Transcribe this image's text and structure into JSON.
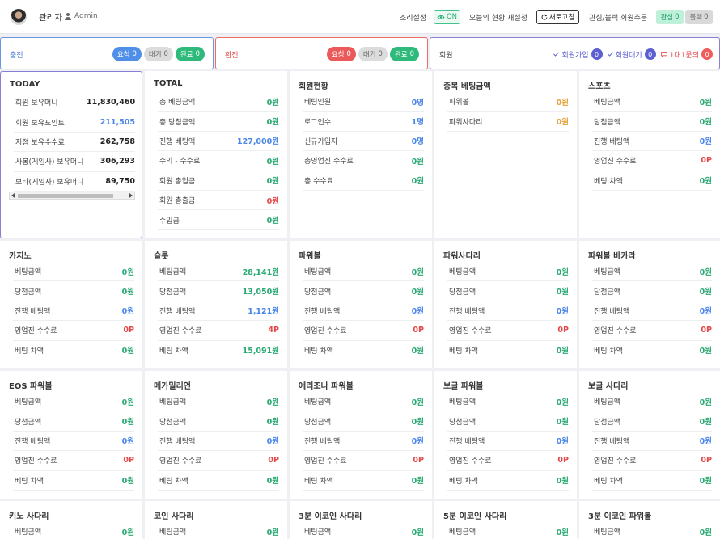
{
  "header": {
    "user_name": "관리자",
    "user_role": "Admin",
    "sound_label": "소리설정",
    "sound_button": "ON",
    "today_reset_label": "오늘의 현황 재설정",
    "refresh_button": "새로고침",
    "interest_label": "관심/블랙 회원주문",
    "interest_button": "관심",
    "interest_count": "0",
    "block_button": "블랙",
    "block_count": "0"
  },
  "status": {
    "deposit": {
      "title": "충전",
      "request": "요청",
      "request_count": "0",
      "wait": "대기",
      "wait_count": "0",
      "done": "완료",
      "done_count": "0"
    },
    "withdraw": {
      "title": "환전",
      "request": "요청",
      "request_count": "0",
      "wait": "대기",
      "wait_count": "0",
      "done": "완료",
      "done_count": "0"
    },
    "member": {
      "title": "회원",
      "join": "회원가입",
      "join_count": "0",
      "wait": "회원대기",
      "wait_count": "0",
      "inquiry": "1대1문의",
      "inquiry_count": "0"
    }
  },
  "cards": {
    "today": {
      "title": "TODAY",
      "rows": [
        {
          "label": "회원 보유머니",
          "value": "11,830,460"
        },
        {
          "label": "회원 보유포인트",
          "value": "211,505"
        },
        {
          "label": "지점 보유수수료",
          "value": "262,758"
        },
        {
          "label": "사봉(게임사) 보유머니",
          "value": "306,293"
        },
        {
          "label": "보타(게임사) 보유머니",
          "value": "89,750"
        }
      ]
    },
    "total": {
      "title": "TOTAL",
      "rows": [
        {
          "label": "총 베팅금액",
          "value": "0원"
        },
        {
          "label": "총 당첨금액",
          "value": "0원"
        },
        {
          "label": "진행 베팅액",
          "value": "127,000원"
        },
        {
          "label": "수익 - 수수료",
          "value": "0원"
        },
        {
          "label": "회원 총입금",
          "value": "0원"
        },
        {
          "label": "회원 총출금",
          "value": "0원"
        },
        {
          "label": "수입금",
          "value": "0원"
        }
      ]
    },
    "member_status": {
      "title": "회원현황",
      "rows": [
        {
          "label": "베팅인원",
          "value": "0명"
        },
        {
          "label": "로그인수",
          "value": "1명"
        },
        {
          "label": "신규가입자",
          "value": "0명"
        },
        {
          "label": "총영업진 수수료",
          "value": "0원"
        },
        {
          "label": "총 수수료",
          "value": "0원"
        }
      ]
    },
    "duplicate": {
      "title": "중복 베팅금액",
      "rows": [
        {
          "label": "파워볼",
          "value": "0원"
        },
        {
          "label": "파워사다리",
          "value": "0원"
        }
      ]
    },
    "sports": {
      "title": "스포츠",
      "rows": [
        {
          "label": "베팅금액",
          "value": "0원"
        },
        {
          "label": "당첨금액",
          "value": "0원"
        },
        {
          "label": "진행 베팅액",
          "value": "0원"
        },
        {
          "label": "영업진 수수료",
          "value": "0P"
        },
        {
          "label": "베팅 차액",
          "value": "0원"
        }
      ]
    },
    "casino": {
      "title": "카지노",
      "rows": [
        {
          "label": "베팅금액",
          "value": "0원"
        },
        {
          "label": "당첨금액",
          "value": "0원"
        },
        {
          "label": "진행 베팅액",
          "value": "0원"
        },
        {
          "label": "영업진 수수료",
          "value": "0P"
        },
        {
          "label": "베팅 차액",
          "value": "0원"
        }
      ]
    },
    "slot": {
      "title": "슬롯",
      "rows": [
        {
          "label": "베팅금액",
          "value": "28,141원"
        },
        {
          "label": "당첨금액",
          "value": "13,050원"
        },
        {
          "label": "진행 베팅액",
          "value": "1,121원"
        },
        {
          "label": "영업진 수수료",
          "value": "4P"
        },
        {
          "label": "베팅 차액",
          "value": "15,091원"
        }
      ]
    },
    "powerball": {
      "title": "파워볼",
      "rows": [
        {
          "label": "베팅금액",
          "value": "0원"
        },
        {
          "label": "당첨금액",
          "value": "0원"
        },
        {
          "label": "진행 베팅액",
          "value": "0원"
        },
        {
          "label": "영업진 수수료",
          "value": "0P"
        },
        {
          "label": "베팅 차액",
          "value": "0원"
        }
      ]
    },
    "power_ladder": {
      "title": "파워사다리",
      "rows": [
        {
          "label": "베팅금액",
          "value": "0원"
        },
        {
          "label": "당첨금액",
          "value": "0원"
        },
        {
          "label": "진행 베팅액",
          "value": "0원"
        },
        {
          "label": "영업진 수수료",
          "value": "0P"
        },
        {
          "label": "베팅 차액",
          "value": "0원"
        }
      ]
    },
    "powerball_baccarat": {
      "title": "파워볼 바카라",
      "rows": [
        {
          "label": "베팅금액",
          "value": "0원"
        },
        {
          "label": "당첨금액",
          "value": "0원"
        },
        {
          "label": "진행 베팅액",
          "value": "0원"
        },
        {
          "label": "영업진 수수료",
          "value": "0P"
        },
        {
          "label": "베팅 차액",
          "value": "0원"
        }
      ]
    },
    "eos_powerball": {
      "title": "EOS 파워볼",
      "rows": [
        {
          "label": "베팅금액",
          "value": "0원"
        },
        {
          "label": "당첨금액",
          "value": "0원"
        },
        {
          "label": "진행 베팅액",
          "value": "0원"
        },
        {
          "label": "영업진 수수료",
          "value": "0P"
        },
        {
          "label": "베팅 차액",
          "value": "0원"
        }
      ]
    },
    "mega_millions": {
      "title": "메가밀리언",
      "rows": [
        {
          "label": "베팅금액",
          "value": "0원"
        },
        {
          "label": "당첨금액",
          "value": "0원"
        },
        {
          "label": "진행 베팅액",
          "value": "0원"
        },
        {
          "label": "영업진 수수료",
          "value": "0P"
        },
        {
          "label": "베팅 차액",
          "value": "0원"
        }
      ]
    },
    "arizona_powerball": {
      "title": "애리조나 파워볼",
      "rows": [
        {
          "label": "베팅금액",
          "value": "0원"
        },
        {
          "label": "당첨금액",
          "value": "0원"
        },
        {
          "label": "진행 베팅액",
          "value": "0원"
        },
        {
          "label": "영업진 수수료",
          "value": "0P"
        },
        {
          "label": "베팅 차액",
          "value": "0원"
        }
      ]
    },
    "bogle_powerball": {
      "title": "보글 파워볼",
      "rows": [
        {
          "label": "베팅금액",
          "value": "0원"
        },
        {
          "label": "당첨금액",
          "value": "0원"
        },
        {
          "label": "진행 베팅액",
          "value": "0원"
        },
        {
          "label": "영업진 수수료",
          "value": "0P"
        },
        {
          "label": "베팅 차액",
          "value": "0원"
        }
      ]
    },
    "bogle_ladder": {
      "title": "보글 사다리",
      "rows": [
        {
          "label": "베팅금액",
          "value": "0원"
        },
        {
          "label": "당첨금액",
          "value": "0원"
        },
        {
          "label": "진행 베팅액",
          "value": "0원"
        },
        {
          "label": "영업진 수수료",
          "value": "0P"
        },
        {
          "label": "베팅 차액",
          "value": "0원"
        }
      ]
    },
    "keno_ladder": {
      "title": "키노 사다리",
      "rows": [
        {
          "label": "베팅금액",
          "value": "0원"
        }
      ]
    },
    "coin_ladder": {
      "title": "코인 사다리",
      "rows": [
        {
          "label": "베팅금액",
          "value": "0원"
        }
      ]
    },
    "coin3_ladder": {
      "title": "3분 이코인 사다리",
      "rows": [
        {
          "label": "베팅금액",
          "value": "0원"
        }
      ]
    },
    "coin5_ladder": {
      "title": "5분 이코인 사다리",
      "rows": [
        {
          "label": "베팅금액",
          "value": "0원"
        }
      ]
    },
    "coin3_powerball": {
      "title": "3분 이코인 파워볼",
      "rows": [
        {
          "label": "베팅금액",
          "value": "0원"
        }
      ]
    }
  }
}
